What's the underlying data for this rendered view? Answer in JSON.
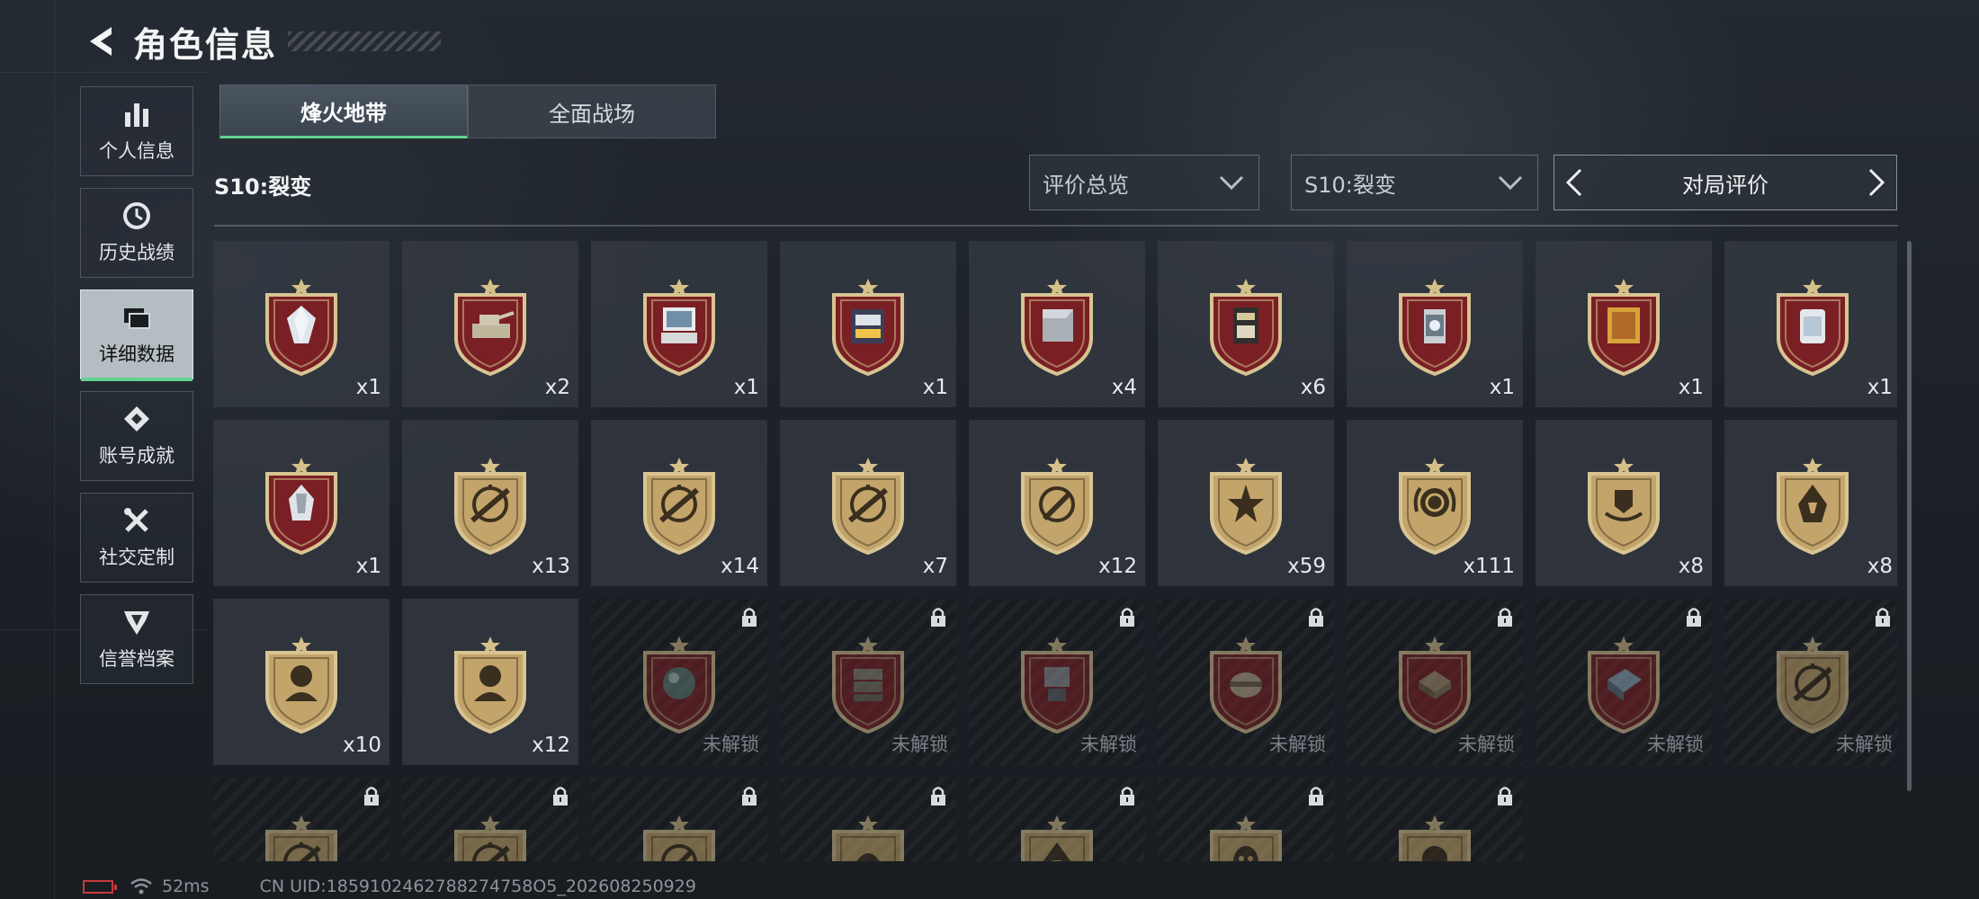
{
  "header": {
    "title": "角色信息"
  },
  "sidebar": {
    "items": [
      {
        "label": "个人信息",
        "icon": "bar-chart-icon"
      },
      {
        "label": "历史战绩",
        "icon": "clock-icon"
      },
      {
        "label": "详细数据",
        "icon": "folders-icon",
        "active": true
      },
      {
        "label": "账号成就",
        "icon": "achievement-icon"
      },
      {
        "label": "社交定制",
        "icon": "tools-icon"
      },
      {
        "label": "信誉档案",
        "icon": "shield-emblem-icon"
      }
    ]
  },
  "tabs": [
    {
      "label": "烽火地带",
      "active": true
    },
    {
      "label": "全面战场",
      "active": false
    }
  ],
  "season": {
    "label": "S10:裂变",
    "filter1": "评价总览",
    "filter2": "S10:裂变",
    "pager_label": "对局评价"
  },
  "badges": [
    {
      "kind": "red",
      "item": "diamond",
      "count": "x1"
    },
    {
      "kind": "red",
      "item": "tank",
      "count": "x2"
    },
    {
      "kind": "red",
      "item": "computer",
      "count": "x1"
    },
    {
      "kind": "red",
      "item": "tablet",
      "count": "x1"
    },
    {
      "kind": "red",
      "item": "plate",
      "count": "x4"
    },
    {
      "kind": "red",
      "item": "circuit",
      "count": "x6"
    },
    {
      "kind": "red",
      "item": "reactor",
      "count": "x1"
    },
    {
      "kind": "red",
      "item": "painting",
      "count": "x1"
    },
    {
      "kind": "red",
      "item": "capsule",
      "count": "x1"
    },
    {
      "kind": "red",
      "item": "crystal",
      "count": "x1"
    },
    {
      "kind": "gold",
      "item": "crosshair-rifle",
      "count": "x13"
    },
    {
      "kind": "gold",
      "item": "crosshair-rifle",
      "count": "x14"
    },
    {
      "kind": "gold",
      "item": "crosshair-rifle",
      "count": "x7"
    },
    {
      "kind": "gold",
      "item": "crosshair-knife",
      "count": "x12"
    },
    {
      "kind": "gold",
      "item": "star-burst",
      "count": "x59"
    },
    {
      "kind": "gold",
      "item": "laurel",
      "count": "x111"
    },
    {
      "kind": "gold",
      "item": "shield-wings",
      "count": "x8"
    },
    {
      "kind": "gold",
      "item": "hood",
      "count": "x8"
    },
    {
      "kind": "gold",
      "item": "soldier",
      "count": "x10"
    },
    {
      "kind": "gold",
      "item": "soldier",
      "count": "x12"
    },
    {
      "kind": "red",
      "item": "orb",
      "locked": true,
      "status": "未解锁"
    },
    {
      "kind": "red",
      "item": "crates",
      "locked": true,
      "status": "未解锁"
    },
    {
      "kind": "red",
      "item": "machine",
      "locked": true,
      "status": "未解锁"
    },
    {
      "kind": "red",
      "item": "case",
      "locked": true,
      "status": "未解锁"
    },
    {
      "kind": "red",
      "item": "chessboard",
      "locked": true,
      "status": "未解锁"
    },
    {
      "kind": "red",
      "item": "device",
      "locked": true,
      "status": "未解锁"
    },
    {
      "kind": "gold",
      "item": "crosshair-rifle",
      "locked": true,
      "status": "未解锁"
    },
    {
      "kind": "gold",
      "item": "crosshair-rifle",
      "locked": true,
      "status": ""
    },
    {
      "kind": "gold",
      "item": "crosshair-rifle",
      "locked": true,
      "status": ""
    },
    {
      "kind": "gold",
      "item": "crosshair-knife",
      "locked": true,
      "status": ""
    },
    {
      "kind": "gold",
      "item": "helmet",
      "locked": true,
      "status": ""
    },
    {
      "kind": "gold",
      "item": "hood",
      "locked": true,
      "status": ""
    },
    {
      "kind": "gold",
      "item": "mask",
      "locked": true,
      "status": ""
    },
    {
      "kind": "gold",
      "item": "skull",
      "locked": true,
      "status": ""
    }
  ],
  "footer": {
    "ping": "52ms",
    "uid": "CN UID:1859102462788274758O5_202608250929"
  },
  "colors": {
    "accent_green": "#5fd38d",
    "badge_red": "#7a1f24",
    "badge_gold": "#c8a86a",
    "battery_red": "#c83a3a"
  }
}
